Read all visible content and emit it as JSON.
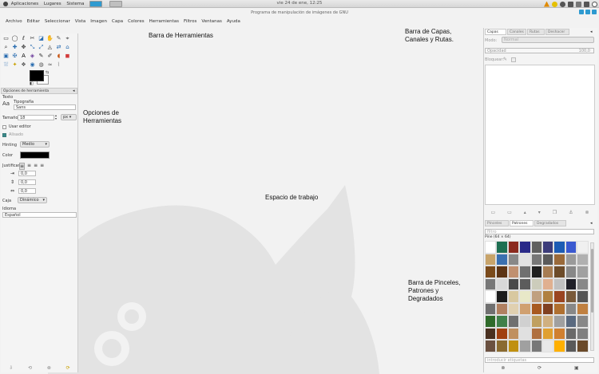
{
  "top_panel": {
    "menus": [
      "Aplicaciones",
      "Lugares",
      "Sistema"
    ],
    "clock": "vie 24 de ene, 12:25",
    "tray_colors": [
      "#e08a00",
      "#e5c000",
      "#555555",
      "#555555",
      "#777777",
      "#555555",
      "#555555"
    ]
  },
  "window": {
    "title": "Programa de manipulación de imágenes de GNU"
  },
  "menubar": [
    "Archivo",
    "Editar",
    "Seleccionar",
    "Vista",
    "Imagen",
    "Capa",
    "Colores",
    "Herramientas",
    "Filtros",
    "Ventanas",
    "Ayuda"
  ],
  "toolbox": {
    "tools": [
      "▭",
      "◯",
      "ℓ",
      "✂",
      "◪",
      "✋",
      "✎",
      "⌖",
      "⌕",
      "✚",
      "✥",
      "⤡",
      "⤢",
      "◬",
      "⇄",
      "⌂",
      "▣",
      "✠",
      "A",
      "◈",
      "✎",
      "✐",
      "◖",
      "◼",
      "⛆",
      "✦",
      "❖",
      "◉",
      "◍",
      "≈",
      "⌇",
      ""
    ],
    "tool_colors": [
      "#333",
      "#333",
      "#333",
      "#333",
      "#2a6db0",
      "#c07020",
      "#6a6a6a",
      "#333",
      "#333",
      "#2a6db0",
      "#333",
      "#2a6db0",
      "#2a6db0",
      "#333",
      "#2a6db0",
      "#2a6db0",
      "#2a6db0",
      "#2a6db0",
      "#000",
      "#6a3a9a",
      "#333",
      "#333",
      "#c85a1a",
      "#d23b3b",
      "#2a6db0",
      "#c8a000",
      "#555",
      "#2a6db0",
      "#555",
      "#555",
      "#888",
      "#f4f4f4"
    ],
    "fg_color": "#000000",
    "bg_color": "#ffffff"
  },
  "tool_options": {
    "tab_label": "Opciones de herramienta",
    "section": "Texto",
    "font_label": "Tipografía",
    "font_value": "Sans",
    "size_label": "Tamaño",
    "size_value": "18",
    "size_unit": "px",
    "use_editor": "Usar editor",
    "antialias": "Alisado",
    "hinting_label": "Hinting",
    "hinting_value": "Medio",
    "color_label": "Color",
    "color_value": "#000000",
    "justify_label": "Justificar",
    "indent_value": "0,0",
    "line_value": "0,0",
    "letter_value": "0,0",
    "box_label": "Caja",
    "box_value": "Dinámico",
    "language_label": "Idioma",
    "language_value": "Español"
  },
  "annotations": {
    "toolbar": "Barra de Herramientas",
    "tool_options": [
      "Opciones de",
      "Herramientas"
    ],
    "layers": [
      "Barra de Capas,",
      "Canales y Rutas."
    ],
    "workspace": "Espacio de trabajo",
    "brushes": [
      "Barra de Pinceles,",
      "Patrones y",
      "Degradados"
    ]
  },
  "layers_dock": {
    "tabs": [
      "Capas",
      "Canales",
      "Rutas",
      "Deshacer"
    ],
    "mode_label": "Modo:",
    "mode_value": "Normal",
    "opacity_label": "Opacidad",
    "opacity_value": "100,0",
    "lock_label": "Bloquear:"
  },
  "patterns_dock": {
    "tabs": [
      "Pinceles",
      "Patrones",
      "Degradados"
    ],
    "filter_placeholder": "filtro",
    "pattern_name": "Pine (64 × 64)",
    "tag_placeholder": "introducir etiquetas",
    "patterns": [
      "#ffffff",
      "#1e6f52",
      "#8b2a1e",
      "#2a2a88",
      "#5f5f5f",
      "#3c3c7a",
      "#1d5cb4",
      "#3a59d0",
      "#f0f0f0",
      "#c8a46a",
      "#3a70b0",
      "#888888",
      "#e2e2e2",
      "#777777",
      "#5a5a5a",
      "#9a6a3a",
      "#9a9a9a",
      "#b0b0b0",
      "#7a4a1a",
      "#5c3414",
      "#c09070",
      "#707070",
      "#202020",
      "#a67c52",
      "#6d4c2a",
      "#888888",
      "#a0a0a0",
      "#777777",
      "#d8d8d8",
      "#4a4a4a",
      "#5c5c5c",
      "#ccccbb",
      "#e0b090",
      "#c0c0c0",
      "#202028",
      "#888888",
      "#ffffff",
      "#1c1c1c",
      "#d8c8a0",
      "#e8e8c8",
      "#c0a080",
      "#b08040",
      "#9a4420",
      "#7a5a3a",
      "#555555",
      "#707070",
      "#b08060",
      "#e0d0b0",
      "#d0a070",
      "#a85a20",
      "#804020",
      "#b07030",
      "#888888",
      "#c08040",
      "#2f6a2a",
      "#40804a",
      "#707070",
      "#d0d0d0",
      "#c0a060",
      "#d0b080",
      "#a0a0a0",
      "#5a6a80",
      "#888888",
      "#4a3020",
      "#a04010",
      "#c09060",
      "#e0e0e0",
      "#b07040",
      "#e0a030",
      "#d08030",
      "#6a6a6a",
      "#808080",
      "#6a5040",
      "#8a6a30",
      "#c09010",
      "#a0a0a0",
      "#787878",
      "#e8e8e8",
      "#ffb000",
      "#5a5a5a",
      "#6a4a2a",
      "#3a6ac0",
      "#7a8ab0",
      "#6080d0",
      "#9a9a9a",
      "#202020",
      "#1f4fa0",
      "#b0b0b0",
      "#6a7a90",
      "#4070c0"
    ]
  }
}
